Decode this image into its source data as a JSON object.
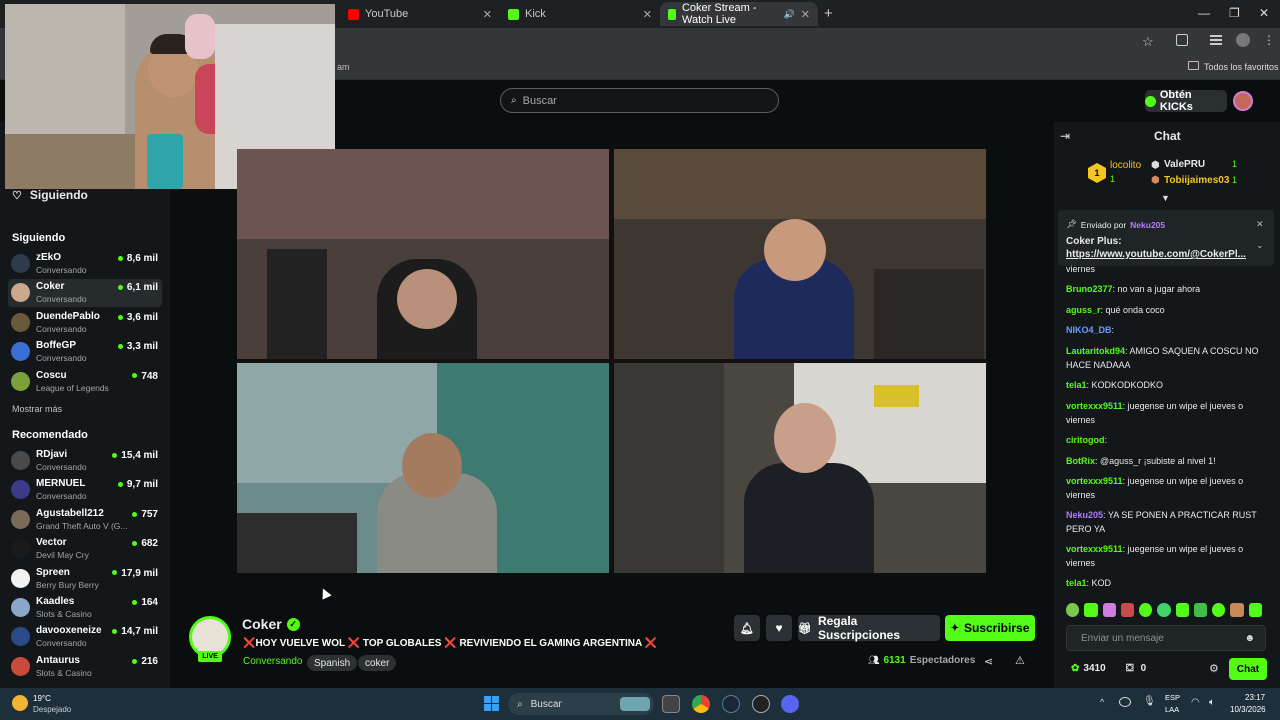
{
  "browser": {
    "tabs": [
      {
        "label": "YouTube",
        "favicon_color": "#ff0000"
      },
      {
        "label": "Kick",
        "favicon_color": "#53fc18"
      },
      {
        "label": "Coker Stream - Watch Live",
        "favicon_color": "#53fc18",
        "active": true
      }
    ],
    "bookmarks_partial": "am",
    "all_bookmarks": "Todos los favoritos"
  },
  "header": {
    "search_placeholder": "Buscar",
    "kicks_button": "Obtén KICKs"
  },
  "sidebar": {
    "following_header": "Siguiendo",
    "following_section": "Siguiendo",
    "following": [
      {
        "name": "zEkO",
        "sub": "Conversando",
        "viewers": "8,6 mil",
        "color": "#2e3b4c"
      },
      {
        "name": "Coker",
        "sub": "Conversando",
        "viewers": "6,1 mil",
        "color": "#c9a98b"
      },
      {
        "name": "DuendePablo",
        "sub": "Conversando",
        "viewers": "3,6 mil",
        "color": "#6a5a3a"
      },
      {
        "name": "BoffeGP",
        "sub": "Conversando",
        "viewers": "3,3 mil",
        "color": "#3a6fd8"
      },
      {
        "name": "Coscu",
        "sub": "League of Legends",
        "viewers": "748",
        "color": "#7aa13a"
      }
    ],
    "show_more": "Mostrar más",
    "recommended_section": "Recomendado",
    "recommended": [
      {
        "name": "RDjavi",
        "sub": "Conversando",
        "viewers": "15,4 mil",
        "color": "#4a4a4a"
      },
      {
        "name": "MERNUEL",
        "sub": "Conversando",
        "viewers": "9,7 mil",
        "color": "#3b3b8a"
      },
      {
        "name": "Agustabell212",
        "sub": "Grand Theft Auto V (G...",
        "viewers": "757",
        "color": "#7a6a5a"
      },
      {
        "name": "Vector",
        "sub": "Devil May Cry",
        "viewers": "682",
        "color": "#1a1a1a"
      },
      {
        "name": "Spreen",
        "sub": "Berry Bury Berry",
        "viewers": "17,9 mil",
        "color": "#f2f2f2"
      },
      {
        "name": "Kaadles",
        "sub": "Slots & Casino",
        "viewers": "164",
        "color": "#8aa7c9"
      },
      {
        "name": "davooxeneize",
        "sub": "Conversando",
        "viewers": "14,7 mil",
        "color": "#2a4a8a"
      },
      {
        "name": "Antaurus",
        "sub": "Slots & Casino",
        "viewers": "216",
        "color": "#c94a3a"
      }
    ]
  },
  "stream": {
    "channel": "Coker",
    "live": "LIVE",
    "title": "❌HOY VUELVE WOL ❌ TOP GLOBALES ❌ REVIVIENDO EL GAMING ARGENTINA ❌",
    "category": "Conversando",
    "tags": [
      "Spanish",
      "coker"
    ],
    "gift_button": "Regala Suscripciones",
    "subscribe_button": "Suscribirse",
    "viewers": "6131",
    "viewers_label": "Espectadores"
  },
  "chat": {
    "title": "Chat",
    "gifters": {
      "top": {
        "name": "locolito",
        "count": "1"
      },
      "second": {
        "name": "ValePRU",
        "count": "1"
      },
      "third": {
        "name": "Tobiijaimes03",
        "count": "1"
      }
    },
    "pinned": {
      "sent_by": "Enviado por",
      "user": "Neku205",
      "label": "Coker Plus:",
      "link": "https://www.youtube.com/@CokerPl..."
    },
    "messages": [
      {
        "user": "",
        "text": "viernes",
        "color": "#e8eaeb"
      },
      {
        "user": "Bruno2377",
        "text": ": no van a jugar ahora",
        "color": "#53fc18"
      },
      {
        "user": "aguss_r",
        "text": ": qué onda coco",
        "color": "#53fc18"
      },
      {
        "user": "NIKO4_DB",
        "text": ":",
        "color": "#6c9cff"
      },
      {
        "user": "Lautaritokd94",
        "text": ": AMIGO SAQUEN A COSCU NO HACE NADAAA",
        "color": "#53fc18"
      },
      {
        "user": "tela1",
        "text": ": KODKODKODKO",
        "color": "#53fc18"
      },
      {
        "user": "vortexxx9511",
        "text": ": juegense un wipe el jueves o viernes",
        "color": "#53fc18"
      },
      {
        "user": "ciritogod",
        "text": ":",
        "color": "#53fc18"
      },
      {
        "user": "BotRix",
        "text": ": @aguss_r ¡subiste al nivel 1!",
        "color": "#53fc18"
      },
      {
        "user": "vortexxx9511",
        "text": ": juegense un wipe el jueves o viernes",
        "color": "#53fc18"
      },
      {
        "user": "Neku205",
        "text": ": YA SE PONEN A PRACTICAR RUST PERO YA",
        "color": "#b27cff"
      },
      {
        "user": "vortexxx9511",
        "text": ": juegense un wipe el jueves o viernes",
        "color": "#53fc18"
      },
      {
        "user": "tela1",
        "text": ": KOD",
        "color": "#53fc18"
      }
    ],
    "input_placeholder": "Enviar un mensaje",
    "points": "3410",
    "gifts": "0",
    "send_button": "Chat"
  },
  "taskbar": {
    "weather_temp": "19°C",
    "weather_desc": "Despejado",
    "search": "Buscar",
    "lang": "ESP",
    "lang2": "LAA",
    "time": "23:17",
    "date": "10/3/2026"
  }
}
